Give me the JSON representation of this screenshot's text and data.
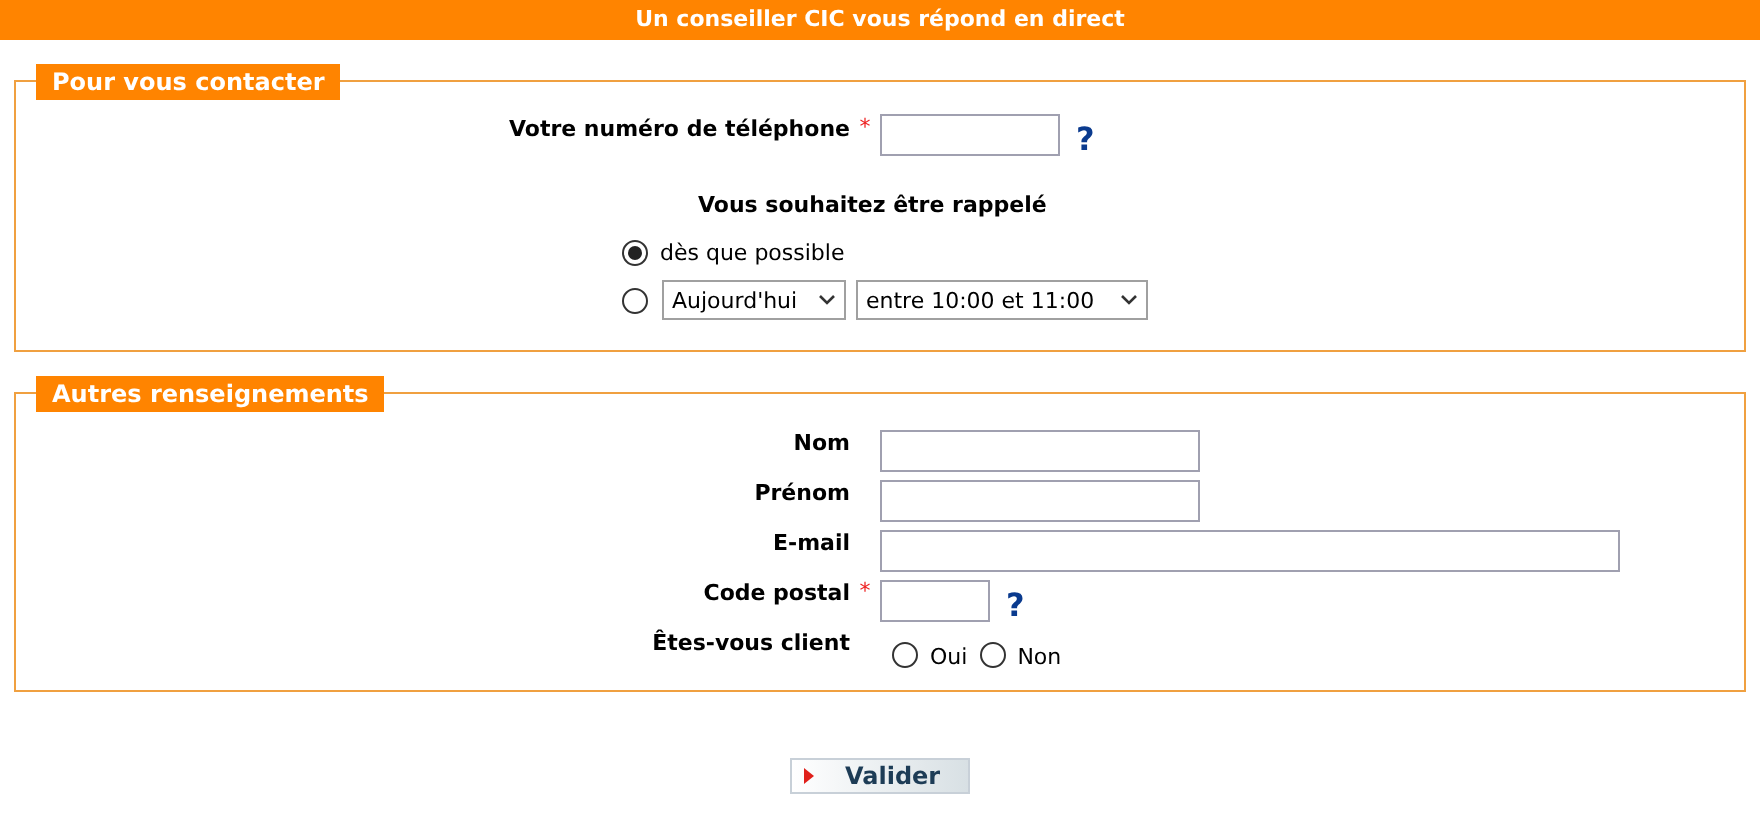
{
  "header": {
    "title": "Un conseiller CIC vous répond en direct"
  },
  "contact": {
    "legend": "Pour vous contacter",
    "phone": {
      "label": "Votre numéro de téléphone",
      "mark": "*",
      "help": "?"
    },
    "callback": {
      "title": "Vous souhaitez être rappelé",
      "options": [
        {
          "kind": "text",
          "label": "dès que possible",
          "selected": true
        },
        {
          "kind": "selects",
          "day": "Aujourd'hui",
          "time": "entre 10:00 et 11:00",
          "selected": false
        }
      ]
    }
  },
  "other": {
    "legend": "Autres renseignements",
    "fields": [
      {
        "kind": "medium",
        "label": "Nom"
      },
      {
        "kind": "medium",
        "label": "Prénom"
      },
      {
        "kind": "long",
        "label": "E-mail"
      },
      {
        "kind": "short",
        "label": "Code postal",
        "mark": "*",
        "help": "?"
      },
      {
        "kind": "radios",
        "label": "Êtes-vous client",
        "options": [
          {
            "label": "Oui",
            "selected": false
          },
          {
            "label": "Non",
            "selected": false
          }
        ]
      }
    ]
  },
  "submit": {
    "label": "Valider"
  }
}
